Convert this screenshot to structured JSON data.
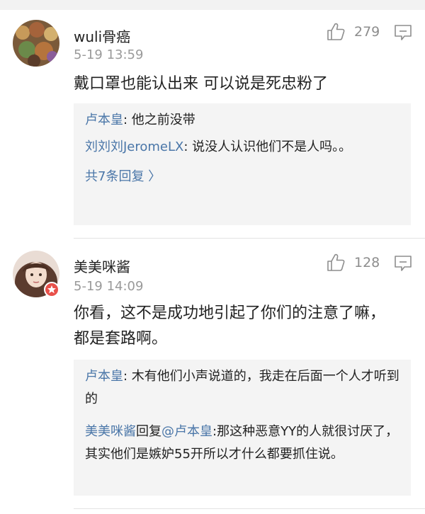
{
  "comments": [
    {
      "username": "wuli骨癌",
      "time": "5-19 13:59",
      "likes": "279",
      "text": "戴口罩也能认出来 可以说是死忠粉了",
      "replies": [
        {
          "name": "卢本皇",
          "sep": ": ",
          "text": "他之前没带"
        },
        {
          "name": "刘刘刘JeromeLX",
          "sep": ": ",
          "text": "说没人认识他们不是人吗。。"
        }
      ],
      "more": "共7条回复 〉"
    },
    {
      "username": "美美咪酱",
      "time": "5-19 14:09",
      "likes": "128",
      "text": "你看，这不是成功地引起了你们的注意了嘛，都是套路啊。",
      "replies": [
        {
          "name": "卢本皇",
          "sep": ": ",
          "text": "木有他们小声说道的，我走在后面一个人才听到的"
        },
        {
          "name": "美美咪酱",
          "mid": "回复",
          "mention": "@卢本皇",
          "sep": ":",
          "text": "那这种恶意YY的人就很讨厌了，其实他们是嫉妒55开所以才什么都要抓住说。"
        }
      ]
    }
  ],
  "colors": {
    "link": "#4a76a8",
    "reply_bg": "#f4f4f4",
    "meta": "#9a9a9a"
  },
  "icons": {
    "like": "thumbs-up-icon",
    "reply": "comment-bubble-icon",
    "verified": "verified-badge-icon"
  }
}
